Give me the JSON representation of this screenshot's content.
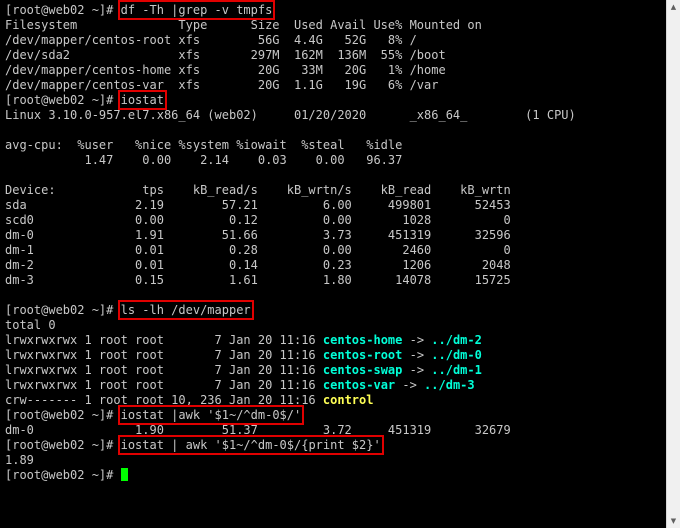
{
  "terminal": {
    "prompt": "[root@web02 ~]#",
    "lines": [
      {
        "type": "prompt",
        "cmd": "df -Th |grep -v tmpfs"
      },
      {
        "type": "out",
        "text": "Filesystem              Type      Size  Used Avail Use% Mounted on"
      },
      {
        "type": "out",
        "text": "/dev/mapper/centos-root xfs        56G  4.4G   52G   8% /"
      },
      {
        "type": "out",
        "text": "/dev/sda2               xfs       297M  162M  136M  55% /boot"
      },
      {
        "type": "out",
        "text": "/dev/mapper/centos-home xfs        20G   33M   20G   1% /home"
      },
      {
        "type": "out",
        "text": "/dev/mapper/centos-var  xfs        20G  1.1G   19G   6% /var"
      },
      {
        "type": "prompt",
        "cmd": "iostat"
      },
      {
        "type": "out",
        "text": "Linux 3.10.0-957.el7.x86_64 (web02)     01/20/2020      _x86_64_        (1 CPU)"
      },
      {
        "type": "out",
        "text": ""
      },
      {
        "type": "out",
        "text": "avg-cpu:  %user   %nice %system %iowait  %steal   %idle"
      },
      {
        "type": "out",
        "text": "           1.47    0.00    2.14    0.03    0.00   96.37"
      },
      {
        "type": "out",
        "text": ""
      },
      {
        "type": "out",
        "text": "Device:            tps    kB_read/s    kB_wrtn/s    kB_read    kB_wrtn"
      },
      {
        "type": "out",
        "text": "sda               2.19        57.21         6.00     499801      52453"
      },
      {
        "type": "out",
        "text": "scd0              0.00         0.12         0.00       1028          0"
      },
      {
        "type": "out",
        "text": "dm-0              1.91        51.66         3.73     451319      32596"
      },
      {
        "type": "out",
        "text": "dm-1              0.01         0.28         0.00       2460          0"
      },
      {
        "type": "out",
        "text": "dm-2              0.01         0.14         0.23       1206       2048"
      },
      {
        "type": "out",
        "text": "dm-3              0.15         1.61         1.80      14078      15725"
      },
      {
        "type": "out",
        "text": ""
      },
      {
        "type": "prompt",
        "cmd": "ls -lh /dev/mapper"
      },
      {
        "type": "out",
        "text": "total 0"
      },
      {
        "type": "ls",
        "text": "lrwxrwxrwx 1 root root       7 Jan 20 11:16 ",
        "name": "centos-home",
        "arrow": " -> ",
        "target": "../dm-2"
      },
      {
        "type": "ls",
        "text": "lrwxrwxrwx 1 root root       7 Jan 20 11:16 ",
        "name": "centos-root",
        "arrow": " -> ",
        "target": "../dm-0"
      },
      {
        "type": "ls",
        "text": "lrwxrwxrwx 1 root root       7 Jan 20 11:16 ",
        "name": "centos-swap",
        "arrow": " -> ",
        "target": "../dm-1"
      },
      {
        "type": "ls",
        "text": "lrwxrwxrwx 1 root root       7 Jan 20 11:16 ",
        "name": "centos-var",
        "arrow": " -> ",
        "target": "../dm-3"
      },
      {
        "type": "dev",
        "text": "crw------- 1 root root 10, 236 Jan 20 11:16 ",
        "name": "control"
      },
      {
        "type": "prompt",
        "cmd": "iostat |awk '$1~/^dm-0$/'"
      },
      {
        "type": "out",
        "text": "dm-0              1.90        51.37         3.72     451319      32679"
      },
      {
        "type": "prompt",
        "cmd": "iostat | awk '$1~/^dm-0$/{print $2}'"
      },
      {
        "type": "out",
        "text": "1.89"
      },
      {
        "type": "cursor"
      }
    ]
  },
  "colors": {
    "background": "#000000",
    "text": "#c8c8c8",
    "symlink": "#00ffd8",
    "device": "#ffff55",
    "cursor": "#00ff00",
    "highlight_box": "#e00000"
  },
  "scrollbar": {
    "up_icon": "▲",
    "down_icon": "▼"
  }
}
